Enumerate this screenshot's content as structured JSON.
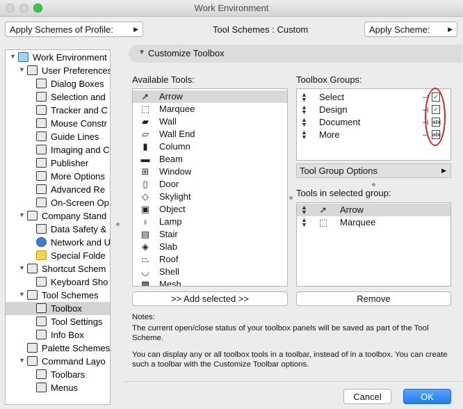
{
  "window": {
    "title": "Work Environment"
  },
  "toolbar": {
    "apply_profile_label": "Apply Schemes of Profile:",
    "tool_schemes_text": "Tool Schemes : Custom",
    "apply_scheme_label": "Apply Scheme:"
  },
  "sidebar": {
    "items": [
      {
        "label": "Work Environment",
        "indent": 0,
        "expanded": true
      },
      {
        "label": "User Preferences",
        "indent": 1,
        "expanded": true
      },
      {
        "label": "Dialog Boxes",
        "indent": 2
      },
      {
        "label": "Selection and",
        "indent": 2
      },
      {
        "label": "Tracker and C",
        "indent": 2
      },
      {
        "label": "Mouse Constr",
        "indent": 2
      },
      {
        "label": "Guide Lines",
        "indent": 2
      },
      {
        "label": "Imaging and C",
        "indent": 2
      },
      {
        "label": "Publisher",
        "indent": 2
      },
      {
        "label": "More Options",
        "indent": 2
      },
      {
        "label": "Advanced Re",
        "indent": 2
      },
      {
        "label": "On-Screen Op",
        "indent": 2
      },
      {
        "label": "Company Stand",
        "indent": 1,
        "expanded": true
      },
      {
        "label": "Data Safety &",
        "indent": 2
      },
      {
        "label": "Network and U",
        "indent": 2
      },
      {
        "label": "Special Folde",
        "indent": 2
      },
      {
        "label": "Shortcut Schem",
        "indent": 1,
        "expanded": true
      },
      {
        "label": "Keyboard Sho",
        "indent": 2
      },
      {
        "label": "Tool Schemes",
        "indent": 1,
        "expanded": true
      },
      {
        "label": "Toolbox",
        "indent": 2,
        "selected": true
      },
      {
        "label": "Tool Settings",
        "indent": 2
      },
      {
        "label": "Info Box",
        "indent": 2
      },
      {
        "label": "Palette Schemes",
        "indent": 1
      },
      {
        "label": "Command Layo",
        "indent": 1,
        "expanded": true
      },
      {
        "label": "Toolbars",
        "indent": 2
      },
      {
        "label": "Menus",
        "indent": 2
      }
    ]
  },
  "main": {
    "section_title": "Customize Toolbox",
    "available_label": "Available Tools:",
    "available_tools": [
      {
        "label": "Arrow",
        "icon": "arrow-icon",
        "glyph": "➚",
        "selected": true
      },
      {
        "label": "Marquee",
        "icon": "marquee-icon",
        "glyph": "⬚"
      },
      {
        "label": "Wall",
        "icon": "wall-icon",
        "glyph": "▰"
      },
      {
        "label": "Wall End",
        "icon": "wall-end-icon",
        "glyph": "▱"
      },
      {
        "label": "Column",
        "icon": "column-icon",
        "glyph": "▮"
      },
      {
        "label": "Beam",
        "icon": "beam-icon",
        "glyph": "▬"
      },
      {
        "label": "Window",
        "icon": "window-icon",
        "glyph": "⊞"
      },
      {
        "label": "Door",
        "icon": "door-icon",
        "glyph": "▯"
      },
      {
        "label": "Skylight",
        "icon": "skylight-icon",
        "glyph": "◇"
      },
      {
        "label": "Object",
        "icon": "object-icon",
        "glyph": "▣"
      },
      {
        "label": "Lamp",
        "icon": "lamp-icon",
        "glyph": "♁"
      },
      {
        "label": "Stair",
        "icon": "stair-icon",
        "glyph": "▤"
      },
      {
        "label": "Slab",
        "icon": "slab-icon",
        "glyph": "◈"
      },
      {
        "label": "Roof",
        "icon": "roof-icon",
        "glyph": "⏢"
      },
      {
        "label": "Shell",
        "icon": "shell-icon",
        "glyph": "◡"
      },
      {
        "label": "Mesh",
        "icon": "mesh-icon",
        "glyph": "▩"
      }
    ],
    "add_selected_label": ">> Add selected >>",
    "groups_label": "Toolbox Groups:",
    "groups": [
      {
        "label": "Select",
        "badge": "✓"
      },
      {
        "label": "Design",
        "badge": "✓"
      },
      {
        "label": "Document",
        "badge": "abc"
      },
      {
        "label": "More",
        "badge": "abc"
      }
    ],
    "tool_group_options_label": "Tool Group Options",
    "tools_in_group_label": "Tools in selected group:",
    "tools_in_group": [
      {
        "label": "Arrow",
        "icon": "arrow-icon",
        "glyph": "➚",
        "selected": true
      },
      {
        "label": "Marquee",
        "icon": "marquee-icon",
        "glyph": "⬚"
      }
    ],
    "remove_label": "Remove",
    "notes_title": "Notes:",
    "notes_p1": "The current open/close status of your toolbox panels will be saved as part of the Tool Scheme.",
    "notes_p2": "You can display any or all toolbox tools in a toolbar, instead of in a toolbox. You can create such a toolbar with the Customize Toolbar options."
  },
  "footer": {
    "cancel_label": "Cancel",
    "ok_label": "OK"
  },
  "colors": {
    "accent": "#1f7cf2",
    "annotation_red": "#d42020",
    "selection": "#d4d4d4"
  }
}
